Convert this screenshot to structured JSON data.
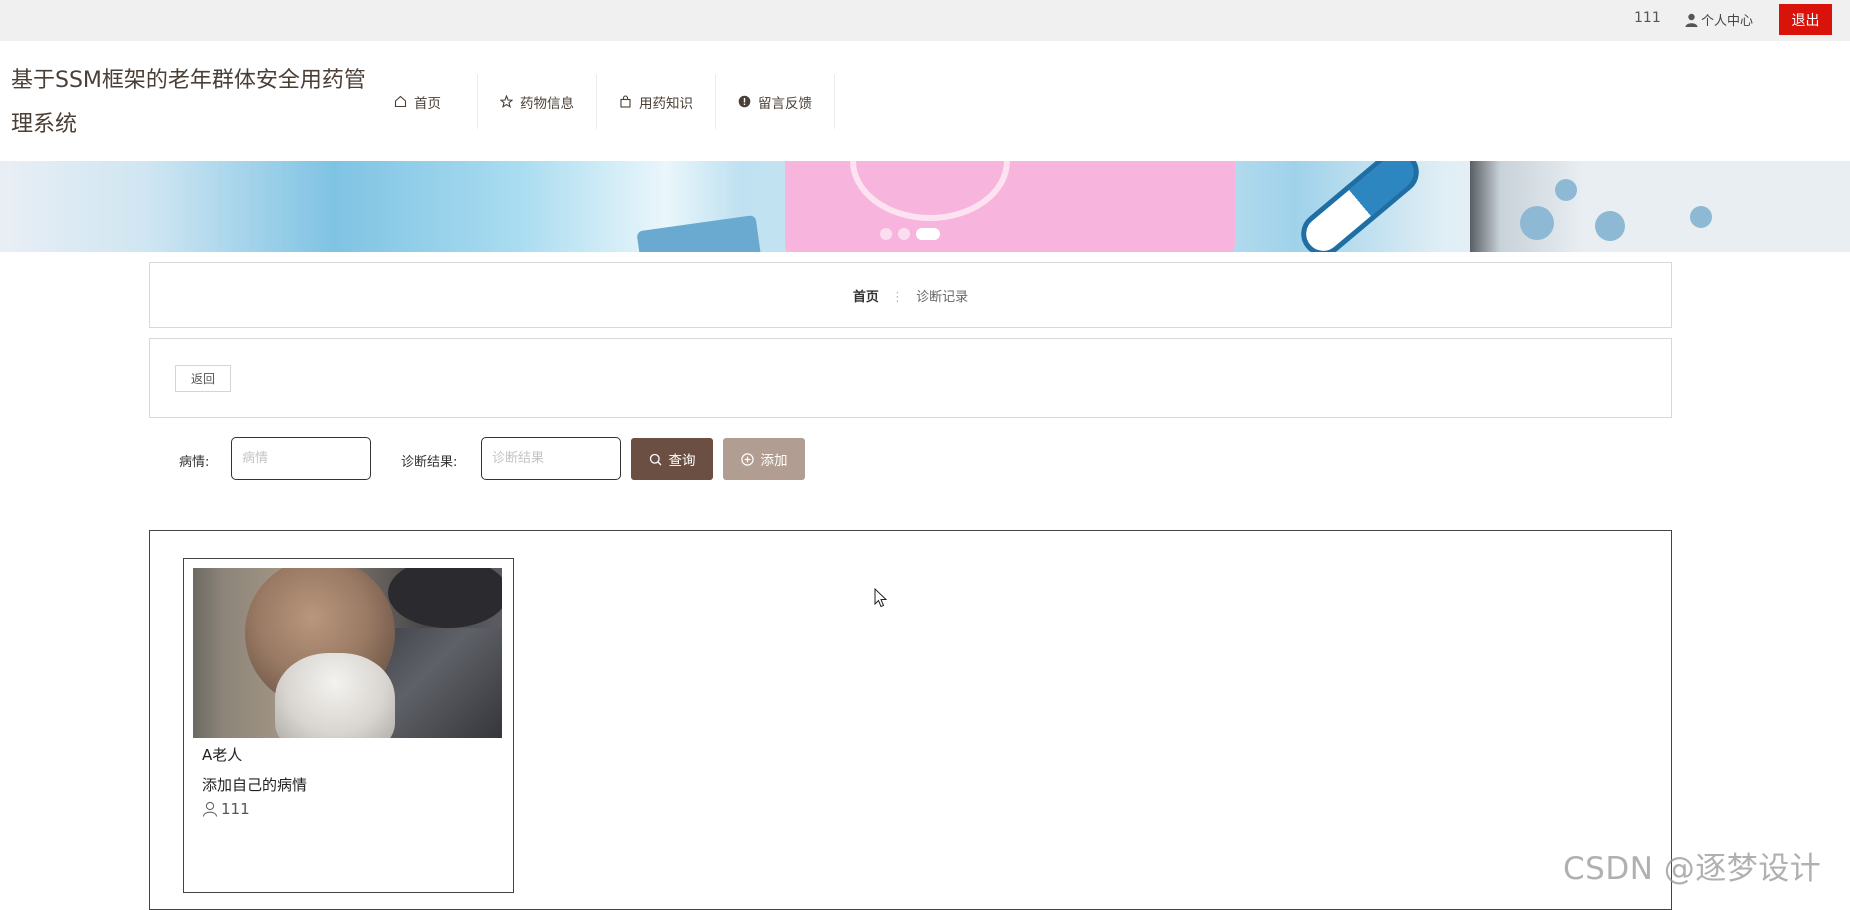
{
  "topbar": {
    "username": "111",
    "user_center": "个人中心",
    "logout": "退出"
  },
  "site": {
    "title": "基于SSM框架的老年群体安全用药管理系统"
  },
  "nav": [
    {
      "label": "首页",
      "icon": "home-icon"
    },
    {
      "label": "药物信息",
      "icon": "star-icon"
    },
    {
      "label": "用药知识",
      "icon": "bag-icon"
    },
    {
      "label": "留言反馈",
      "icon": "alert-circle-icon"
    }
  ],
  "banner": {
    "slides": 3,
    "active_slide": 3
  },
  "breadcrumb": {
    "home": "首页",
    "current": "诊断记录"
  },
  "back_label": "返回",
  "search": {
    "condition_label": "病情:",
    "condition_placeholder": "病情",
    "result_label": "诊断结果:",
    "result_placeholder": "诊断结果",
    "search_button": "查询",
    "add_button": "添加"
  },
  "records": [
    {
      "name": "A老人",
      "description": "添加自己的病情",
      "user": "111"
    }
  ],
  "watermark": "CSDN @逐梦设计",
  "colors": {
    "primary": "#6a4f42",
    "secondary": "#b29d92",
    "logout": "#d9120a"
  }
}
